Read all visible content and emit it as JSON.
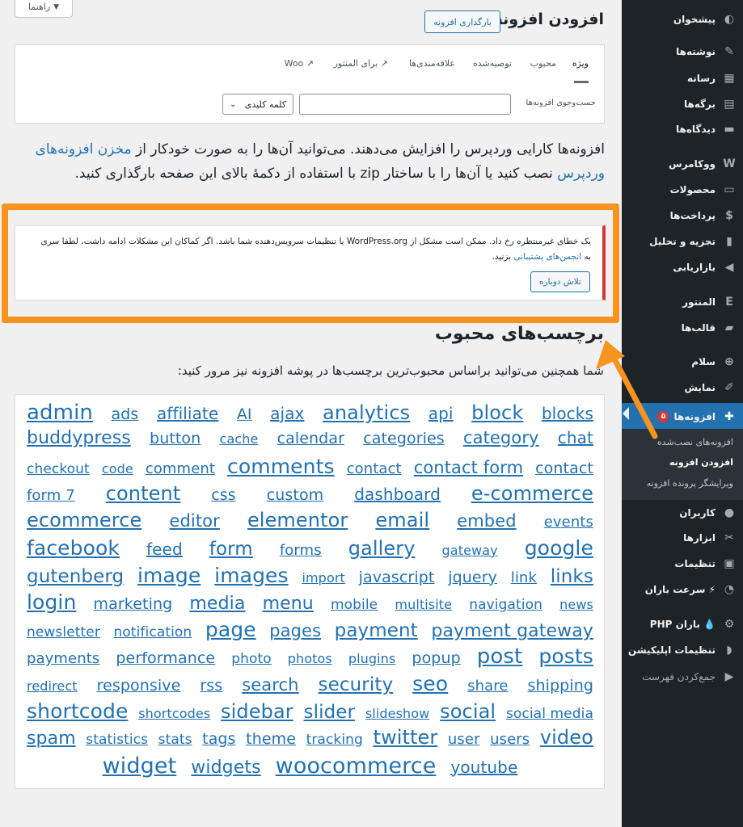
{
  "sidebar": {
    "items": [
      {
        "label": "پیشخوان",
        "icon": "dashboard-icon",
        "glyph": "◐"
      },
      {
        "label": "نوشته‌ها",
        "icon": "pin-icon",
        "glyph": "✎"
      },
      {
        "label": "رسانه",
        "icon": "media-icon",
        "glyph": "▦"
      },
      {
        "label": "برگه‌ها",
        "icon": "pages-icon",
        "glyph": "▤"
      },
      {
        "label": "دیدگاه‌ها",
        "icon": "comments-icon",
        "glyph": "▬"
      },
      {
        "label": "ووکامرس",
        "icon": "woocommerce-icon",
        "glyph": "W"
      },
      {
        "label": "محصولات",
        "icon": "products-icon",
        "glyph": "▭"
      },
      {
        "label": "پرداخت‌ها",
        "icon": "payments-icon",
        "glyph": "$"
      },
      {
        "label": "تجزیه و تحلیل",
        "icon": "analytics-icon",
        "glyph": "▮"
      },
      {
        "label": "بازاریابی",
        "icon": "megaphone-icon",
        "glyph": "◀"
      },
      {
        "label": "المنتور",
        "icon": "elementor-icon",
        "glyph": "E"
      },
      {
        "label": "قالب‌ها",
        "icon": "templates-icon",
        "glyph": "▰"
      },
      {
        "label": "سلام",
        "icon": "plus-circle-icon",
        "glyph": "⊕"
      },
      {
        "label": "نمایش",
        "icon": "appearance-icon",
        "glyph": "✐"
      },
      {
        "label": "افزونه‌ها",
        "icon": "plugins-icon",
        "glyph": "✚",
        "badge": "۵"
      },
      {
        "label": "کاربران",
        "icon": "users-icon",
        "glyph": "●"
      },
      {
        "label": "ابزارها",
        "icon": "tools-icon",
        "glyph": "✂"
      },
      {
        "label": "تنظیمات",
        "icon": "settings-icon",
        "glyph": "▣"
      },
      {
        "label": "سرعت باران ⚡",
        "icon": "speed-icon",
        "glyph": "◔"
      },
      {
        "label": "PHP باران 💧",
        "icon": "gear-icon",
        "glyph": "⚙"
      },
      {
        "label": "تنظیمات اپلیکیشن",
        "icon": "app-icon",
        "glyph": "◗"
      },
      {
        "label": "جمع‌کردن فهرست",
        "icon": "collapse-icon",
        "glyph": "▶"
      }
    ],
    "submenu": [
      "افزونه‌های نصب‌شده",
      "افزودن افزونه",
      "ویرایشگر پرونده افزونه"
    ]
  },
  "help_tab": "راهنما",
  "header": {
    "title": "افزودن افزونه",
    "upload_button": "بارگذاری افزونه"
  },
  "filter": {
    "tabs": [
      "ویژه",
      "محبوب",
      "توصیه‌شده",
      "علاقه‌مندی‌ها",
      "برای المنتور",
      "Woo"
    ],
    "search_label": "جست‌وجوی افزونه‌ها",
    "search_type": "کلمه کلیدی"
  },
  "intro": {
    "before": "افزونه‌ها کارایی وردپرس را افزایش می‌دهند. می‌توانید آن‌ها را به صورت خودکار از ",
    "link": "مخزن افزونه‌های وردپرس",
    "after": " نصب کنید یا آن‌ها را با ساختار zip با استفاده از دکمهٔ بالای این صفحه بارگذاری کنید."
  },
  "notice": {
    "text_before": "یک خطای غیرمنتظره رخ داد. ممکن است مشکل از WordPress.org یا تنظیمات سرویس‌دهنده شما باشد. اگر کماکان این مشکلات ادامه داشت، لطفا سری به ",
    "link": "انجمن‌های پشتیبانی",
    "text_after": " بزنید.",
    "retry_button": "تلاش دوباره"
  },
  "popular": {
    "title": "برچسب‌های محبوب",
    "description": "شما همچنین می‌توانید براساس محبوب‌ترین برچسب‌ها در پوشه افزونه نیز مرور کنید:"
  },
  "tag_lines": [
    [
      [
        "admin",
        26
      ],
      [
        "ads",
        19
      ],
      [
        "affiliate",
        20
      ],
      [
        "AI",
        19
      ],
      [
        "ajax",
        20
      ],
      [
        "analytics",
        24
      ],
      [
        "api",
        20
      ],
      [
        "block",
        24
      ],
      [
        "blocks",
        20
      ]
    ],
    [
      [
        "buddypress",
        22
      ],
      [
        "button",
        19
      ],
      [
        "cache",
        16
      ],
      [
        "calendar",
        19
      ],
      [
        "categories",
        19
      ],
      [
        "category",
        21
      ],
      [
        "chat",
        20
      ]
    ],
    [
      [
        "checkout",
        17
      ],
      [
        "code",
        16
      ],
      [
        "comment",
        18
      ],
      [
        "comments",
        25
      ],
      [
        "contact",
        18
      ],
      [
        "contact form",
        21
      ],
      [
        "contact",
        19
      ]
    ],
    [
      [
        "form 7",
        18
      ],
      [
        "content",
        24
      ],
      [
        "css",
        19
      ],
      [
        "custom",
        19
      ],
      [
        "dashboard",
        20
      ],
      [
        "e-commerce",
        24
      ]
    ],
    [
      [
        "ecommerce",
        24
      ],
      [
        "editor",
        21
      ],
      [
        "elementor",
        24
      ],
      [
        "email",
        24
      ],
      [
        "embed",
        21
      ],
      [
        "events",
        18
      ]
    ],
    [
      [
        "facebook",
        25
      ],
      [
        "feed",
        20
      ],
      [
        "form",
        23
      ],
      [
        "forms",
        18
      ],
      [
        "gallery",
        24
      ],
      [
        "gateway",
        16
      ],
      [
        "google",
        25
      ]
    ],
    [
      [
        "gutenberg",
        23
      ],
      [
        "image",
        25
      ],
      [
        "images",
        25
      ],
      [
        "import",
        16
      ],
      [
        "javascript",
        19
      ],
      [
        "jquery",
        19
      ],
      [
        "link",
        18
      ],
      [
        "links",
        23
      ]
    ],
    [
      [
        "login",
        25
      ],
      [
        "marketing",
        19
      ],
      [
        "media",
        22
      ],
      [
        "menu",
        22
      ],
      [
        "mobile",
        17
      ],
      [
        "multisite",
        16
      ],
      [
        "navigation",
        17
      ],
      [
        "news",
        16
      ]
    ],
    [
      [
        "newsletter",
        17
      ],
      [
        "notification",
        17
      ],
      [
        "page",
        25
      ],
      [
        "pages",
        21
      ],
      [
        "payment",
        23
      ],
      [
        "payment gateway",
        22
      ]
    ],
    [
      [
        "payments",
        18
      ],
      [
        "performance",
        19
      ],
      [
        "photo",
        17
      ],
      [
        "photos",
        16
      ],
      [
        "plugins",
        16
      ],
      [
        "popup",
        19
      ],
      [
        "post",
        26
      ],
      [
        "posts",
        25
      ]
    ],
    [
      [
        "redirect",
        16
      ],
      [
        "responsive",
        19
      ],
      [
        "rss",
        19
      ],
      [
        "search",
        21
      ],
      [
        "security",
        23
      ],
      [
        "seo",
        25
      ],
      [
        "share",
        18
      ],
      [
        "shipping",
        19
      ]
    ],
    [
      [
        "shortcode",
        25
      ],
      [
        "shortcodes",
        16
      ],
      [
        "sidebar",
        24
      ],
      [
        "slider",
        23
      ],
      [
        "slideshow",
        16
      ],
      [
        "social",
        24
      ],
      [
        "social media",
        17
      ]
    ],
    [
      [
        "spam",
        22
      ],
      [
        "statistics",
        17
      ],
      [
        "stats",
        17
      ],
      [
        "tags",
        19
      ],
      [
        "theme",
        19
      ],
      [
        "tracking",
        17
      ],
      [
        "twitter",
        24
      ],
      [
        "user",
        18
      ],
      [
        "users",
        18
      ],
      [
        "video",
        24
      ]
    ],
    [
      [
        "widget",
        27
      ],
      [
        "widgets",
        22
      ],
      [
        "woocommerce",
        27
      ],
      [
        "youtube",
        20
      ]
    ]
  ]
}
